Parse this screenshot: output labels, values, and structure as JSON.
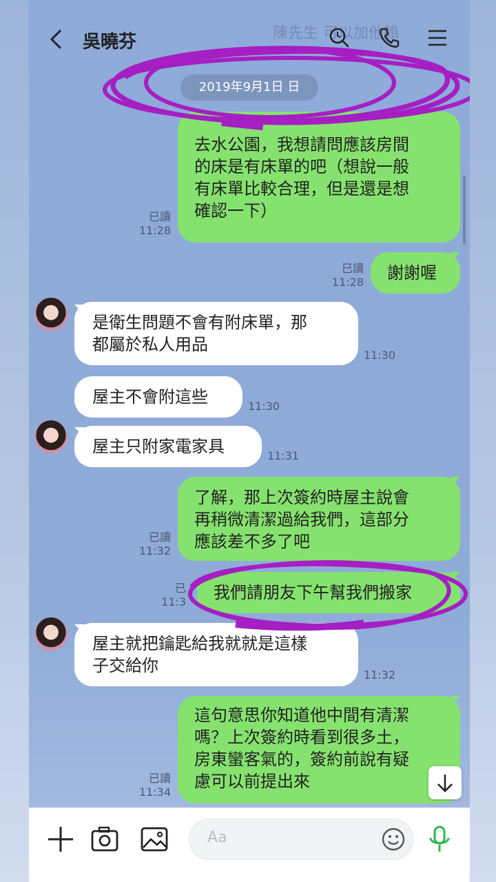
{
  "header": {
    "title": "吳曉芬"
  },
  "top_overlay": {
    "line1": "陳先生 可以加他賴"
  },
  "date_label": "2019年9月1日 日",
  "messages": [
    {
      "side": "out",
      "text_lines": [
        "去水公園，我想請問應該房間",
        "的床是有床單的吧（想說一般",
        "有床單比較合理，但是還是想",
        "確認一下）"
      ],
      "read": "已讀",
      "time": "11:28"
    },
    {
      "side": "out",
      "text_lines": [
        "謝謝喔"
      ],
      "read": "已讀",
      "time": "11:28"
    },
    {
      "side": "in",
      "text_lines": [
        "是衛生問題不會有附床單，那",
        "都屬於私人用品"
      ],
      "time": "11:30"
    },
    {
      "side": "in",
      "text_lines": [
        "屋主不會附這些"
      ],
      "time": "11:30"
    },
    {
      "side": "in",
      "text_lines": [
        "屋主只附家電家具"
      ],
      "time": "11:31"
    },
    {
      "side": "out",
      "text_lines": [
        "了解，那上次簽約時屋主說會",
        "再稍微清潔過給我們，這部分",
        "應該差不多了吧"
      ],
      "read": "已讀",
      "time": "11:32"
    },
    {
      "side": "out",
      "text_lines": [
        "我們請朋友下午幫我們搬家"
      ],
      "read": "已",
      "time": "11:3"
    },
    {
      "side": "in",
      "text_lines": [
        "屋主就把鑰匙給我就就是這樣",
        "子交給你"
      ],
      "time": "11:32"
    },
    {
      "side": "out",
      "text_lines": [
        "這句意思你知道他中間有清潔",
        "嗎？上次簽約時看到很多土，",
        "房東蠻客氣的，簽約前說有疑",
        "慮可以前提出來"
      ],
      "read": "已讀",
      "time": "11:34"
    }
  ],
  "input": {
    "placeholder": "Aa"
  },
  "icons": {
    "back": "chevron-left-icon",
    "search": "search-icon",
    "call": "phone-icon",
    "menu": "menu-icon",
    "plus": "plus-icon",
    "camera": "camera-icon",
    "image": "image-icon",
    "emoji": "emoji-icon",
    "mic": "mic-icon",
    "scroll": "arrow-down-icon"
  },
  "colors": {
    "outgoing": "#86e26f",
    "incoming": "#ffffff",
    "annotation": "#a51fc2",
    "mic": "#2bb94c"
  }
}
